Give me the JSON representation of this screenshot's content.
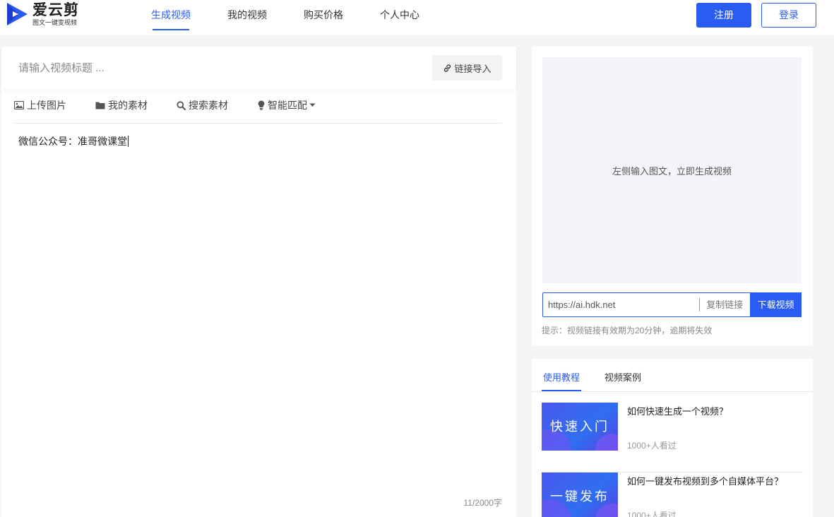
{
  "brand": {
    "name": "爱云剪",
    "slogan": "图文一键变视频",
    "accent_color": "#2b5cf2"
  },
  "nav": {
    "items": [
      {
        "label": "生成视频",
        "active": true
      },
      {
        "label": "我的视频",
        "active": false
      },
      {
        "label": "购买价格",
        "active": false
      },
      {
        "label": "个人中心",
        "active": false
      }
    ]
  },
  "auth": {
    "register_label": "注册",
    "login_label": "登录"
  },
  "editor": {
    "title_placeholder": "请输入视频标题 ...",
    "link_import_label": "链接导入",
    "toolbar": [
      {
        "label": "上传图片",
        "icon": "image-icon"
      },
      {
        "label": "我的素材",
        "icon": "folder-icon"
      },
      {
        "label": "搜索素材",
        "icon": "search-icon"
      },
      {
        "label": "智能匹配",
        "icon": "lightbulb-icon"
      }
    ],
    "content": "微信公众号：准哥微课堂",
    "word_count": "11/2000字"
  },
  "preview": {
    "placeholder_text": "左侧输入图文，立即生成视频",
    "url": "https://ai.hdk.net",
    "copy_label": "复制链接",
    "download_label": "下载视频",
    "tip": "提示：视频链接有效期为20分钟，逾期将失效"
  },
  "tutorials": {
    "tabs": [
      {
        "label": "使用教程",
        "active": true
      },
      {
        "label": "视频案例",
        "active": false
      }
    ],
    "items": [
      {
        "thumb_text": "快速入门",
        "title": "如何快速生成一个视频？",
        "views": "1000+人看过"
      },
      {
        "thumb_text": "一键发布",
        "title": "如何一键发布视频到多个自媒体平台？",
        "views": "1000+人看过"
      }
    ]
  }
}
